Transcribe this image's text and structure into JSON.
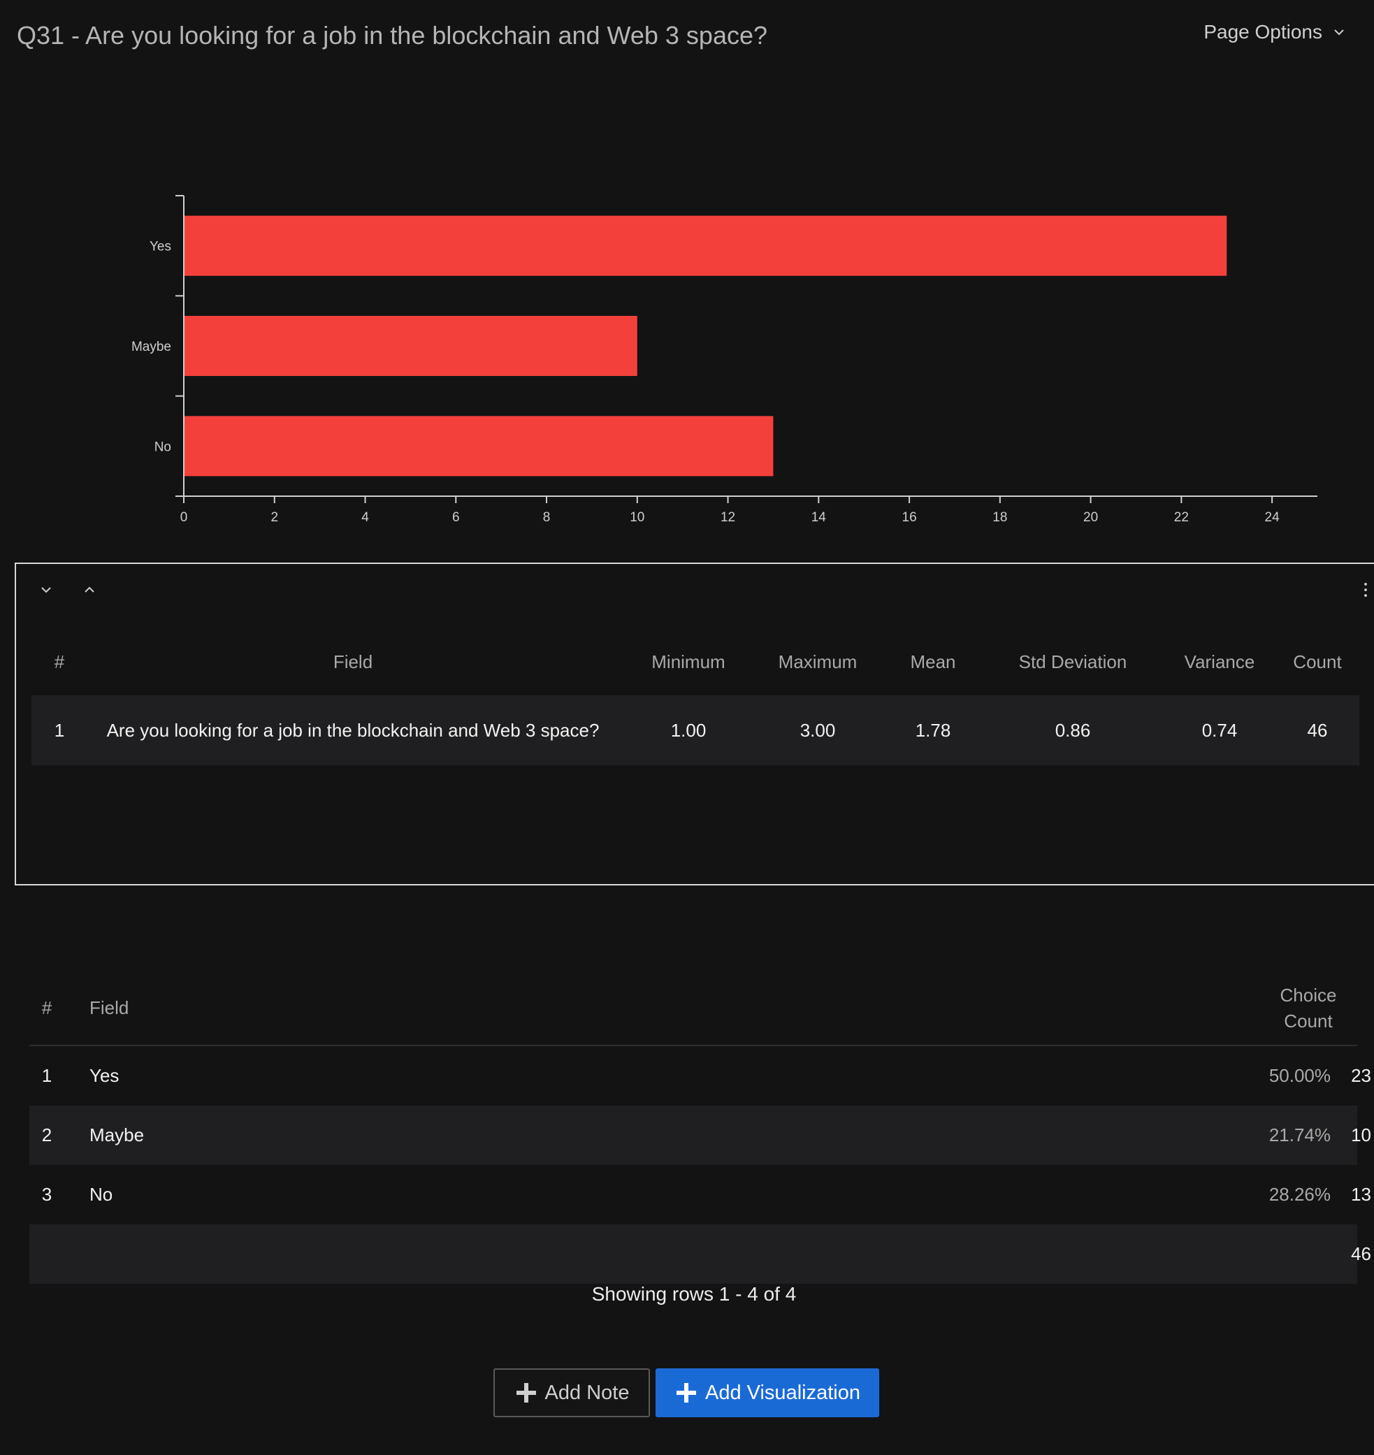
{
  "header": {
    "title": "Q31 - Are you looking for a job in the blockchain and Web 3 space?",
    "page_options_label": "Page Options",
    "page_options_icon": "chevron-down-icon"
  },
  "chart_data": {
    "type": "bar",
    "orientation": "horizontal",
    "categories": [
      "Yes",
      "Maybe",
      "No"
    ],
    "values": [
      23,
      10,
      13
    ],
    "xlim": [
      0,
      25
    ],
    "xticks": [
      0,
      2,
      4,
      6,
      8,
      10,
      12,
      14,
      16,
      18,
      20,
      22,
      24
    ],
    "title": "",
    "xlabel": "",
    "ylabel": "",
    "bar_color": "#f4403b",
    "grid": false
  },
  "stats_panel": {
    "collapse_icon": "chevron-down-icon",
    "expand_icon": "chevron-up-icon",
    "menu_icon": "more-vertical-icon",
    "columns": [
      "#",
      "Field",
      "Minimum",
      "Maximum",
      "Mean",
      "Std Deviation",
      "Variance",
      "Count"
    ],
    "rows": [
      {
        "num": "1",
        "field": "Are you looking for a job in the blockchain and Web 3 space?",
        "min": "1.00",
        "max": "3.00",
        "mean": "1.78",
        "std": "0.86",
        "variance": "0.74",
        "count": "46"
      }
    ]
  },
  "choice_table": {
    "columns": {
      "num": "#",
      "field": "Field",
      "choice_count_line1": "Choice",
      "choice_count_line2": "Count"
    },
    "rows": [
      {
        "num": "1",
        "field": "Yes",
        "pct": "50.00%",
        "count": "23"
      },
      {
        "num": "2",
        "field": "Maybe",
        "pct": "21.74%",
        "count": "10"
      },
      {
        "num": "3",
        "field": "No",
        "pct": "28.26%",
        "count": "13"
      }
    ],
    "total": "46",
    "showing_text": "Showing rows 1 - 4 of 4"
  },
  "actions": {
    "add_note": "Add Note",
    "add_visualization": "Add Visualization"
  },
  "colors": {
    "background": "#131314",
    "bar": "#f4403b",
    "primary_button": "#1a6ad6"
  }
}
